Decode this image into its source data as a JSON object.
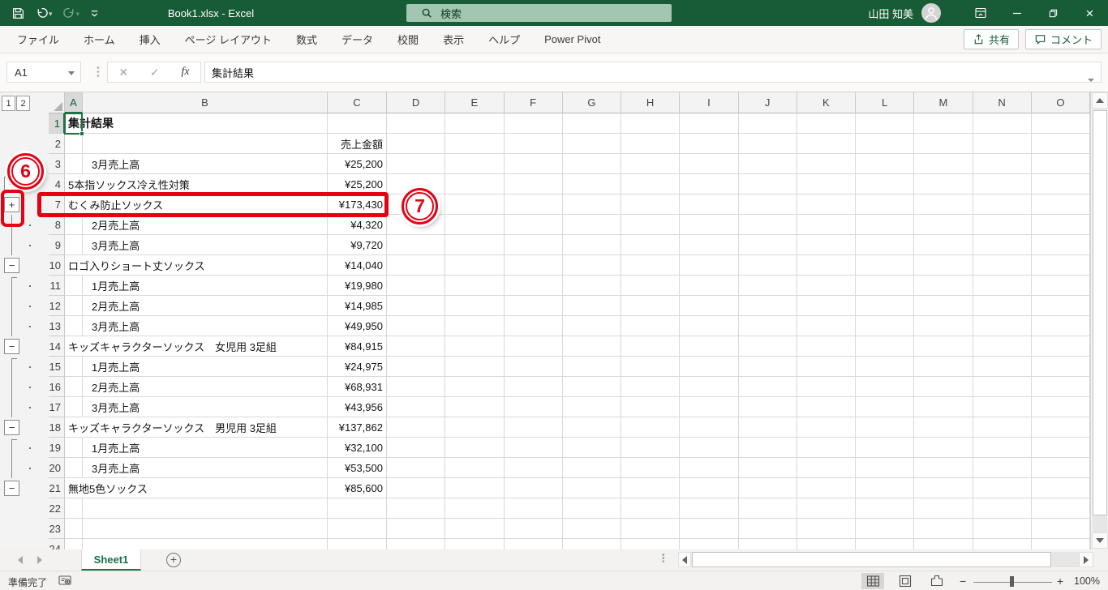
{
  "titlebar": {
    "title": "Book1.xlsx - Excel",
    "search_label": "検索",
    "user_name": "山田 知美"
  },
  "ribbon": {
    "tabs": [
      "ファイル",
      "ホーム",
      "挿入",
      "ページ レイアウト",
      "数式",
      "データ",
      "校閲",
      "表示",
      "ヘルプ",
      "Power Pivot"
    ],
    "share_label": "共有",
    "comment_label": "コメント"
  },
  "formula": {
    "name_box": "A1",
    "cancel_glyph": "✕",
    "enter_glyph": "✓",
    "fx_label": "fx",
    "content": "集計結果"
  },
  "outline": {
    "level1": "1",
    "level2": "2"
  },
  "sheet": {
    "columns": [
      "A",
      "B",
      "C",
      "D",
      "E",
      "F",
      "G",
      "H",
      "I",
      "J",
      "K",
      "L",
      "M",
      "N",
      "O"
    ],
    "selected_column": "A",
    "selected_cell": "A1",
    "rows": [
      {
        "n": "1",
        "label": "集計結果",
        "bold": true,
        "sel": true
      },
      {
        "n": "2",
        "c": "売上金額"
      },
      {
        "n": "3",
        "label": "3月売上高",
        "indent": true,
        "c": "¥25,200",
        "marker": "line-start",
        "dot": true
      },
      {
        "n": "4",
        "label": "5本指ソックス冷え性対策",
        "c": "¥25,200",
        "marker": "minus"
      },
      {
        "n": "7",
        "label": "むくみ防止ソックス",
        "c": "¥173,430",
        "marker": "plus",
        "highlighted": true
      },
      {
        "n": "8",
        "label": "2月売上高",
        "indent": true,
        "c": "¥4,320",
        "marker": "line",
        "dot": true
      },
      {
        "n": "9",
        "label": "3月売上高",
        "indent": true,
        "c": "¥9,720",
        "marker": "line",
        "dot": true
      },
      {
        "n": "10",
        "label": "ロゴ入りショート丈ソックス",
        "c": "¥14,040",
        "marker": "minus"
      },
      {
        "n": "11",
        "label": "1月売上高",
        "indent": true,
        "c": "¥19,980",
        "marker": "line-start",
        "dot": true
      },
      {
        "n": "12",
        "label": "2月売上高",
        "indent": true,
        "c": "¥14,985",
        "marker": "line",
        "dot": true
      },
      {
        "n": "13",
        "label": "3月売上高",
        "indent": true,
        "c": "¥49,950",
        "marker": "line",
        "dot": true
      },
      {
        "n": "14",
        "label": "キッズキャラクターソックス　女児用 3足組",
        "c": "¥84,915",
        "marker": "minus"
      },
      {
        "n": "15",
        "label": "1月売上高",
        "indent": true,
        "c": "¥24,975",
        "marker": "line-start",
        "dot": true
      },
      {
        "n": "16",
        "label": "2月売上高",
        "indent": true,
        "c": "¥68,931",
        "marker": "line",
        "dot": true
      },
      {
        "n": "17",
        "label": "3月売上高",
        "indent": true,
        "c": "¥43,956",
        "marker": "line",
        "dot": true
      },
      {
        "n": "18",
        "label": "キッズキャラクターソックス　男児用 3足組",
        "c": "¥137,862",
        "marker": "minus"
      },
      {
        "n": "19",
        "label": "1月売上高",
        "indent": true,
        "c": "¥32,100",
        "marker": "line-start",
        "dot": true
      },
      {
        "n": "20",
        "label": "3月売上高",
        "indent": true,
        "c": "¥53,500",
        "marker": "line",
        "dot": true
      },
      {
        "n": "21",
        "label": "無地5色ソックス",
        "c": "¥85,600",
        "marker": "minus"
      },
      {
        "n": "22"
      },
      {
        "n": "23"
      },
      {
        "n": "24"
      }
    ]
  },
  "sheet_bar": {
    "tab": "Sheet1",
    "add_glyph": "+"
  },
  "status": {
    "ready": "準備完了",
    "zoom": "100%"
  },
  "annotations": {
    "step6": "6",
    "step7": "7",
    "red": "#E60012"
  },
  "colors": {
    "title_green": "#185C37",
    "accent_green": "#217346",
    "selection_green": "#1E7145"
  }
}
